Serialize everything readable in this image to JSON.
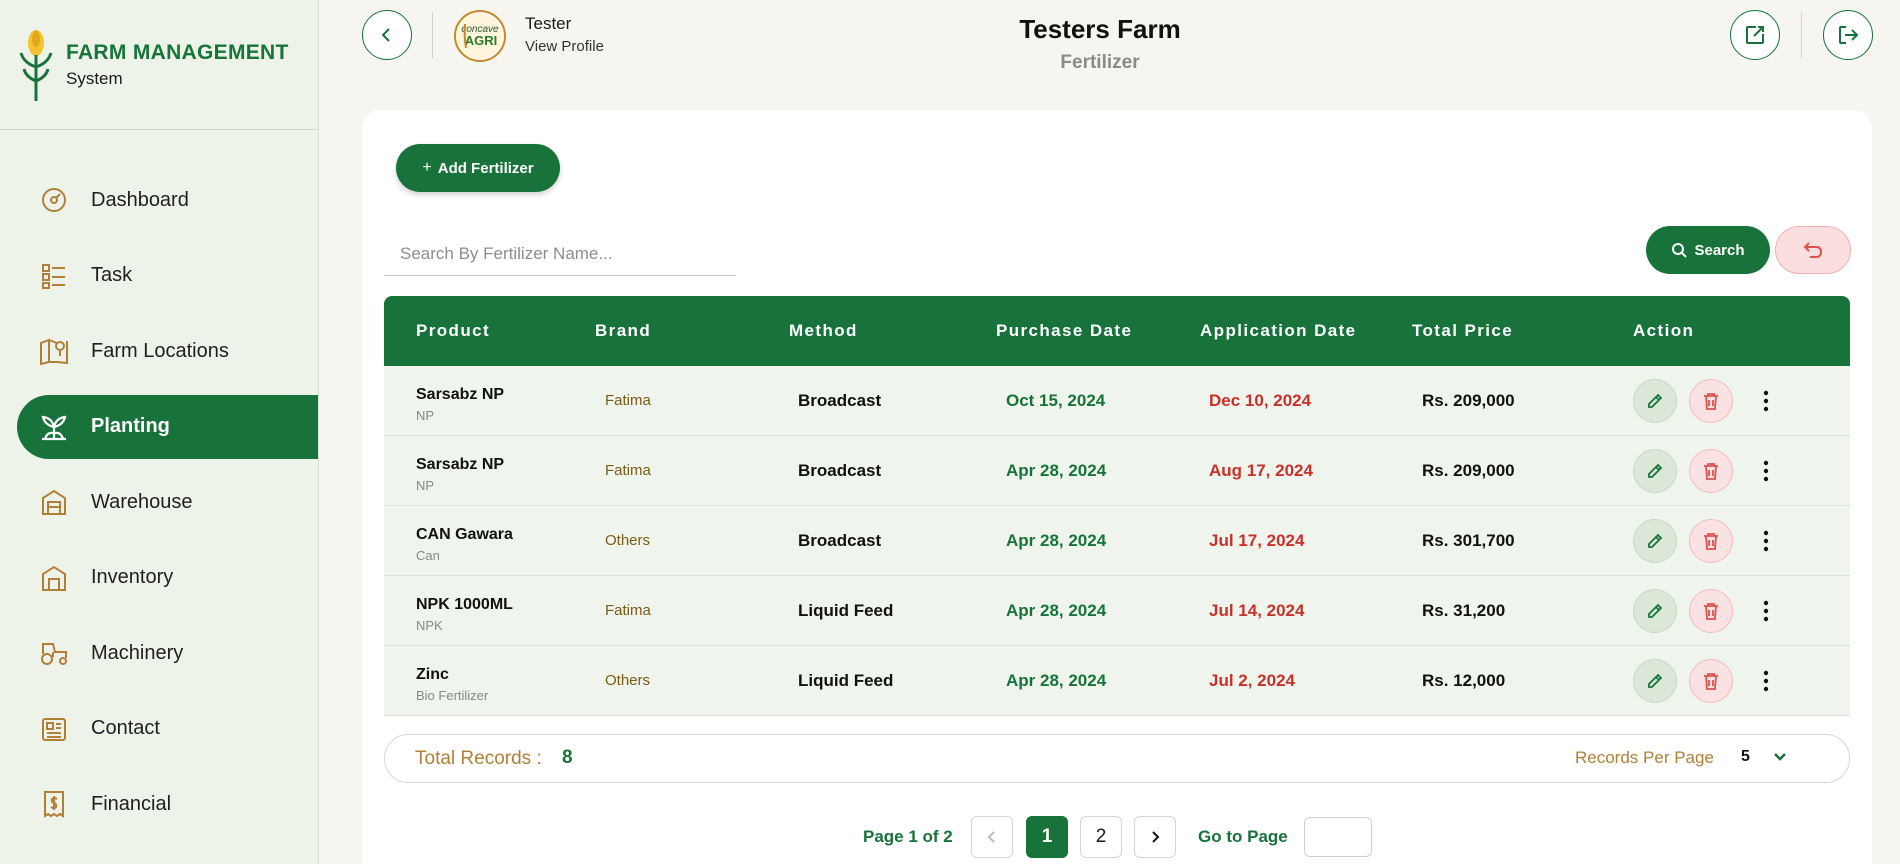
{
  "brand": {
    "title": "FARM MANAGEMENT",
    "subtitle": "System"
  },
  "sidebar": {
    "items": [
      {
        "label": "Dashboard",
        "icon": "dashboard-gauge-icon",
        "active": false
      },
      {
        "label": "Task",
        "icon": "task-list-icon",
        "active": false
      },
      {
        "label": "Farm Locations",
        "icon": "map-pin-icon",
        "active": false
      },
      {
        "label": "Planting",
        "icon": "plant-sprout-icon",
        "active": true
      },
      {
        "label": "Warehouse",
        "icon": "warehouse-icon",
        "active": false
      },
      {
        "label": "Inventory",
        "icon": "inventory-icon",
        "active": false
      },
      {
        "label": "Machinery",
        "icon": "tractor-icon",
        "active": false
      },
      {
        "label": "Contact",
        "icon": "contact-icon",
        "active": false
      },
      {
        "label": "Financial",
        "icon": "receipt-dollar-icon",
        "active": false
      }
    ]
  },
  "header": {
    "user_name": "Tester",
    "view_profile": "View Profile",
    "avatar_logo_text": "concave AGRI",
    "farm_title": "Testers Farm",
    "page_subtitle": "Fertilizer"
  },
  "toolbar": {
    "add_label": "Add Fertilizer",
    "search_placeholder": "Search By Fertilizer Name...",
    "search_label": "Search"
  },
  "table": {
    "columns": [
      "Product",
      "Brand",
      "Method",
      "Purchase Date",
      "Application Date",
      "Total Price",
      "Action"
    ],
    "rows": [
      {
        "product": "Sarsabz NP",
        "type": "NP",
        "brand": "Fatima",
        "method": "Broadcast",
        "purchase_date": "Oct 15, 2024",
        "application_date": "Dec 10, 2024",
        "total_price": "Rs. 209,000"
      },
      {
        "product": "Sarsabz NP",
        "type": "NP",
        "brand": "Fatima",
        "method": "Broadcast",
        "purchase_date": "Apr 28, 2024",
        "application_date": "Aug 17, 2024",
        "total_price": "Rs. 209,000"
      },
      {
        "product": "CAN Gawara",
        "type": "Can",
        "brand": "Others",
        "method": "Broadcast",
        "purchase_date": "Apr 28, 2024",
        "application_date": "Jul 17, 2024",
        "total_price": "Rs. 301,700"
      },
      {
        "product": "NPK 1000ML",
        "type": "NPK",
        "brand": "Fatima",
        "method": "Liquid Feed",
        "purchase_date": "Apr 28, 2024",
        "application_date": "Jul 14, 2024",
        "total_price": "Rs. 31,200"
      },
      {
        "product": "Zinc",
        "type": "Bio Fertilizer",
        "brand": "Others",
        "method": "Liquid Feed",
        "purchase_date": "Apr 28, 2024",
        "application_date": "Jul 2, 2024",
        "total_price": "Rs. 12,000"
      }
    ]
  },
  "footer": {
    "total_label": "Total Records :",
    "total_value": "8",
    "rpp_label": "Records Per Page",
    "rpp_value": "5"
  },
  "pagination": {
    "info": "Page 1 of 2",
    "pages": [
      "1",
      "2"
    ],
    "current": "1",
    "goto_label": "Go to Page"
  },
  "colors": {
    "primary": "#17733a",
    "danger": "#c8302b",
    "accent_gold": "#b08038",
    "sidebar_bg": "#eef3ea"
  }
}
